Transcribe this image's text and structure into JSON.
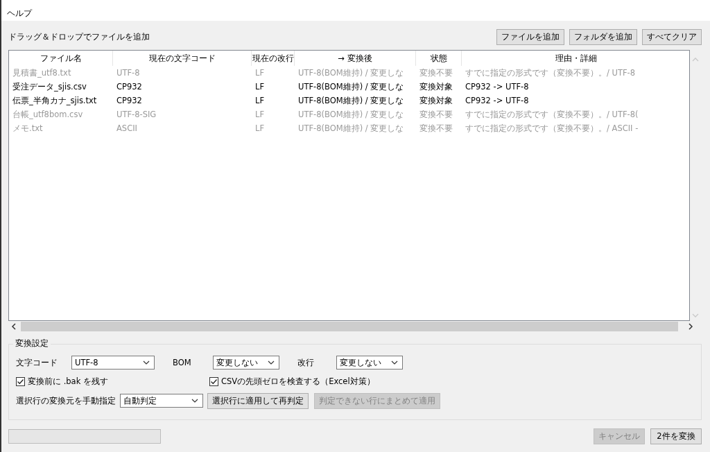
{
  "menu": [
    "ヘルプ"
  ],
  "toolbar": {
    "hint": "ドラッグ＆ドロップでファイルを追加",
    "buttons": [
      "ファイルを追加",
      "フォルダを追加",
      "すべてクリア"
    ]
  },
  "table": {
    "columns": [
      "ファイル名",
      "現在の文字コード",
      "現在の改行",
      "→ 変換後",
      "状態",
      "理由・詳細"
    ],
    "rows": [
      {
        "dimmed": true,
        "cells": [
          "見積書_utf8.txt",
          "UTF-8",
          "LF",
          "UTF-8(BOM維持) / 変更しな",
          "変換不要",
          "すでに指定の形式です（変換不要）。/ UTF-8"
        ]
      },
      {
        "dimmed": false,
        "cells": [
          "受注データ_sjis.csv",
          "CP932",
          "LF",
          "UTF-8(BOM維持) / 変更しな",
          "変換対象",
          "CP932 -> UTF-8"
        ]
      },
      {
        "dimmed": false,
        "cells": [
          "伝票_半角カナ_sjis.txt",
          "CP932",
          "LF",
          "UTF-8(BOM維持) / 変更しな",
          "変換対象",
          "CP932 -> UTF-8"
        ]
      },
      {
        "dimmed": true,
        "cells": [
          "台帳_utf8bom.csv",
          "UTF-8-SIG",
          "LF",
          "UTF-8(BOM維持) / 変更しな",
          "変換不要",
          "すでに指定の形式です（変換不要）。/ UTF-8("
        ]
      },
      {
        "dimmed": true,
        "cells": [
          "メモ.txt",
          "ASCII",
          "LF",
          "UTF-8(BOM維持) / 変更しな",
          "変換不要",
          "すでに指定の形式です（変換不要）。/ ASCII -"
        ]
      }
    ]
  },
  "settings": {
    "title": "変換設定",
    "encoding": {
      "label": "文字コード",
      "value": "UTF-8"
    },
    "bom": {
      "label": "BOM",
      "value": "変更しない"
    },
    "newline": {
      "label": "改行",
      "value": "変更しない"
    },
    "checkboxes": [
      {
        "label": "変換前に .bak を残す",
        "checked": true
      },
      {
        "label": "CSVの先頭ゼロを検査する（Excel対策）",
        "checked": true
      }
    ],
    "manual": {
      "label": "選択行の変換元を手動指定",
      "value": "自動判定"
    },
    "buttons": [
      {
        "label": "選択行に適用して再判定",
        "disabled": false
      },
      {
        "label": "判定できない行にまとめて適用",
        "disabled": true
      }
    ]
  },
  "progress": {
    "level": 0
  },
  "footer_buttons": [
    {
      "label": "キャンセル",
      "disabled": true
    },
    {
      "label": "2件を変換",
      "disabled": false
    }
  ]
}
